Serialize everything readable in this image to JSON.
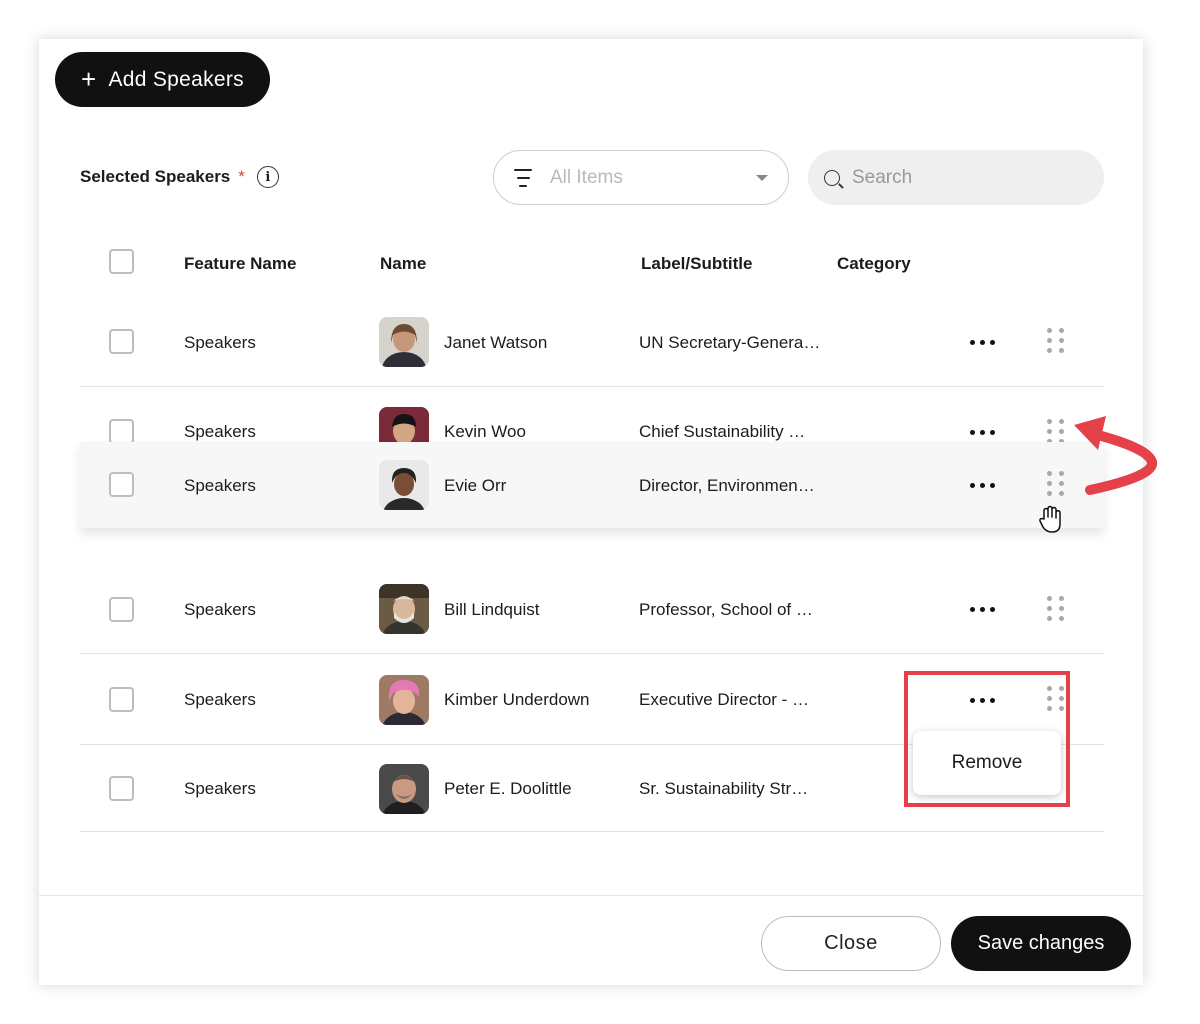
{
  "toolbar": {
    "add_label": "Add Speakers"
  },
  "section": {
    "label": "Selected Speakers",
    "required_mark": "*"
  },
  "filter": {
    "placeholder": "All Items"
  },
  "search": {
    "placeholder": "Search"
  },
  "table": {
    "columns": [
      "Feature Name",
      "Name",
      "Label/Subtitle",
      "Category"
    ],
    "rows": [
      {
        "feature": "Speakers",
        "name": "Janet Watson",
        "subtitle": "UN Secretary-Genera…",
        "category": ""
      },
      {
        "feature": "Speakers",
        "name": "Kevin Woo",
        "subtitle": "Chief Sustainability …",
        "category": ""
      },
      {
        "feature": "Speakers",
        "name": "Evie Orr",
        "subtitle": "Director, Environmen…",
        "category": "",
        "state": "dragging"
      },
      {
        "feature": "Speakers",
        "name": "Bill Lindquist",
        "subtitle": "Professor, School of …",
        "category": ""
      },
      {
        "feature": "Speakers",
        "name": "Kimber Underdown",
        "subtitle": "Executive Director - …",
        "category": ""
      },
      {
        "feature": "Speakers",
        "name": "Peter E. Doolittle",
        "subtitle": "Sr. Sustainability Str…",
        "category": ""
      }
    ]
  },
  "context_menu": {
    "items": [
      "Remove"
    ]
  },
  "footer": {
    "close_label": "Close",
    "save_label": "Save changes"
  },
  "colors": {
    "accent": "#111111",
    "required": "#e53935",
    "annotation": "#e5414a"
  },
  "icons": [
    "plus-icon",
    "info-icon",
    "filter-lines-icon",
    "chevron-down-icon",
    "search-icon",
    "more-dots-icon",
    "drag-grip-icon",
    "hand-cursor-icon",
    "curved-arrow-icon"
  ]
}
